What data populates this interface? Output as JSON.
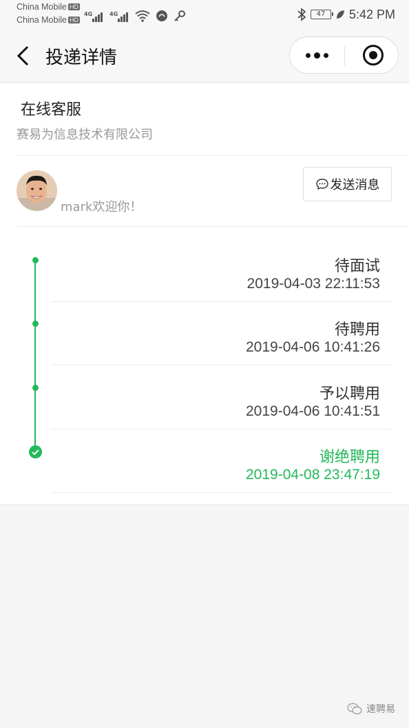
{
  "status_bar": {
    "carrier1": "China Mobile",
    "carrier2": "China Mobile",
    "hd_badge": "HD",
    "network1": "4G",
    "network2": "4G",
    "battery": "47",
    "time": "5:42 PM"
  },
  "nav": {
    "title": "投递详情"
  },
  "company": {
    "section_title": "在线客服",
    "name": "赛易为信息技术有限公司"
  },
  "contact": {
    "greeting": "mark欢迎你！",
    "send_button": "发送消息"
  },
  "timeline": [
    {
      "status": "待面试",
      "time": "2019-04-03 22:11:53"
    },
    {
      "status": "待聘用",
      "time": "2019-04-06 10:41:26"
    },
    {
      "status": "予以聘用",
      "time": "2019-04-06 10:41:51"
    },
    {
      "status": "谢绝聘用",
      "time": "2019-04-08 23:47:19"
    }
  ],
  "watermark": {
    "text": "速聘易"
  },
  "colors": {
    "accent": "#21b95a",
    "text_primary": "#333333",
    "text_secondary": "#999999"
  }
}
